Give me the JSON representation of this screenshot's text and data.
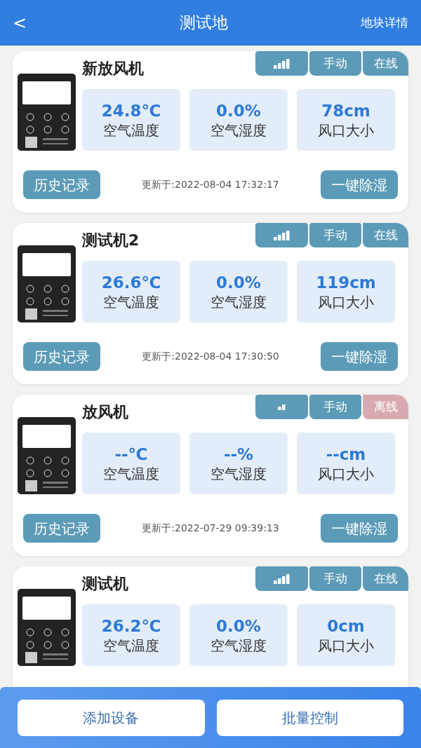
{
  "header": {
    "back": "<",
    "title": "测试地",
    "action": "地块详情"
  },
  "devices": [
    {
      "name": "新放风机",
      "weak_signal": false,
      "mode": "手动",
      "online": true,
      "status": "在线",
      "metrics": [
        {
          "value": "24.8℃",
          "label": "空气温度"
        },
        {
          "value": "0.0%",
          "label": "空气湿度"
        },
        {
          "value": "78cm",
          "label": "风口大小"
        }
      ],
      "history": "历史记录",
      "updated": "更新于:2022-08-04 17:32:17",
      "dehumidify": "一键除湿"
    },
    {
      "name": "测试机2",
      "weak_signal": false,
      "mode": "手动",
      "online": true,
      "status": "在线",
      "metrics": [
        {
          "value": "26.6℃",
          "label": "空气温度"
        },
        {
          "value": "0.0%",
          "label": "空气湿度"
        },
        {
          "value": "119cm",
          "label": "风口大小"
        }
      ],
      "history": "历史记录",
      "updated": "更新于:2022-08-04 17:30:50",
      "dehumidify": "一键除湿"
    },
    {
      "name": "放风机",
      "weak_signal": true,
      "mode": "手动",
      "online": false,
      "status": "离线",
      "metrics": [
        {
          "value": "--℃",
          "label": "空气温度"
        },
        {
          "value": "--%",
          "label": "空气湿度"
        },
        {
          "value": "--cm",
          "label": "风口大小"
        }
      ],
      "history": "历史记录",
      "updated": "更新于:2022-07-29 09:39:13",
      "dehumidify": "一键除湿"
    },
    {
      "name": "测试机",
      "weak_signal": false,
      "mode": "手动",
      "online": true,
      "status": "在线",
      "metrics": [
        {
          "value": "26.2℃",
          "label": "空气温度"
        },
        {
          "value": "0.0%",
          "label": "空气湿度"
        },
        {
          "value": "0cm",
          "label": "风口大小"
        }
      ]
    }
  ],
  "bottom_bar": {
    "buttons": [
      "添加设备",
      "批量控制"
    ]
  }
}
